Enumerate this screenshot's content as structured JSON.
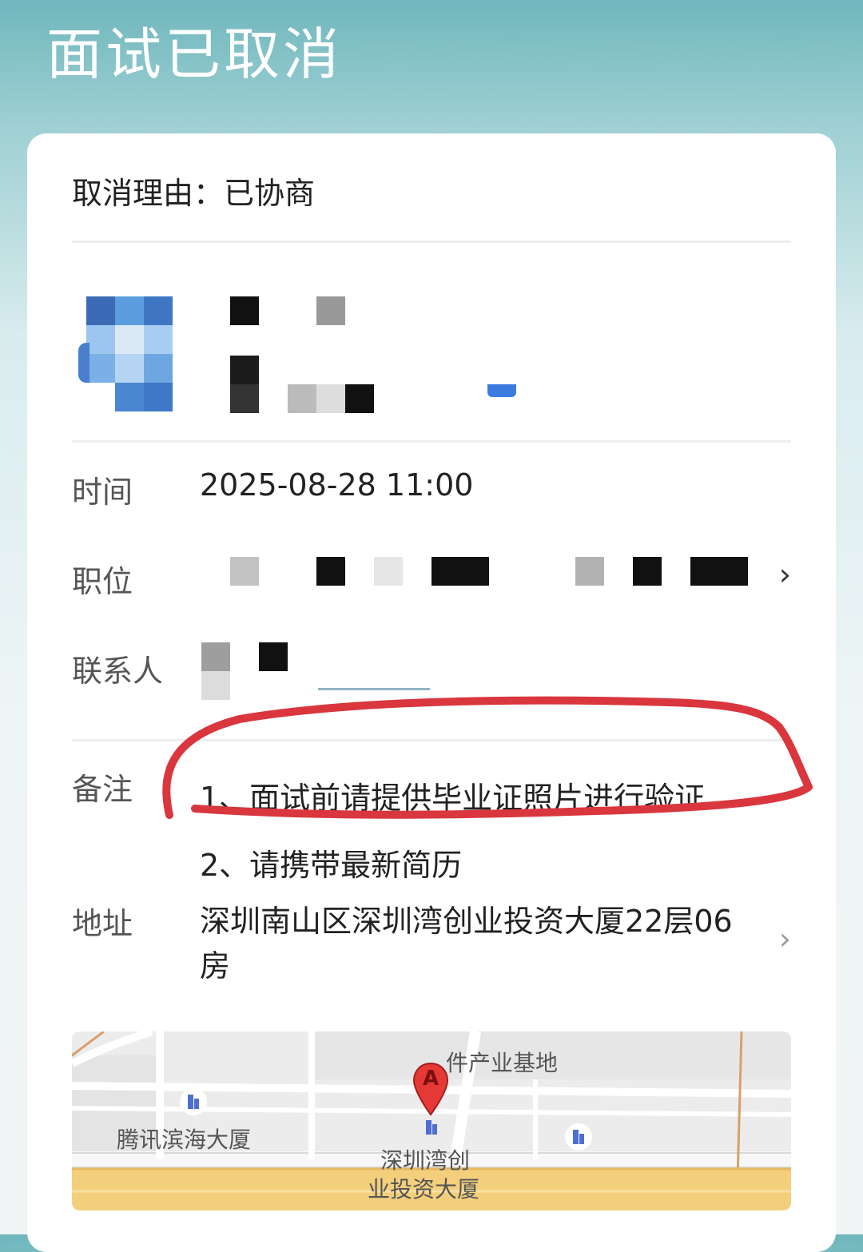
{
  "page": {
    "title": "面试已取消"
  },
  "cancel": {
    "text": "取消理由：已协商"
  },
  "details": {
    "time_label": "时间",
    "time_value": "2025-08-28 11:00",
    "position_label": "职位",
    "contact_label": "联系人",
    "remarks_label": "备注",
    "remarks": [
      "1、面试前请提供毕业证照片进行验证",
      "2、请携带最新简历"
    ],
    "address_label": "地址",
    "address_value": "深圳南山区深圳湾创业投资大厦22层06房"
  },
  "map": {
    "labels": {
      "base": "件产业基地",
      "tencent": "腾讯滨海大厦",
      "target_line1": "深圳湾创",
      "target_line2": "业投资大厦"
    },
    "marker_letter": "A"
  },
  "icons": {
    "chevron": "chevron-right-icon",
    "pin": "map-pin-icon",
    "building": "building-icon"
  },
  "colors": {
    "header_top": "#6fb7bd",
    "annotation_red": "#d9363e",
    "marker_red": "#e53935",
    "road_yellow": "#f3cf7c"
  }
}
